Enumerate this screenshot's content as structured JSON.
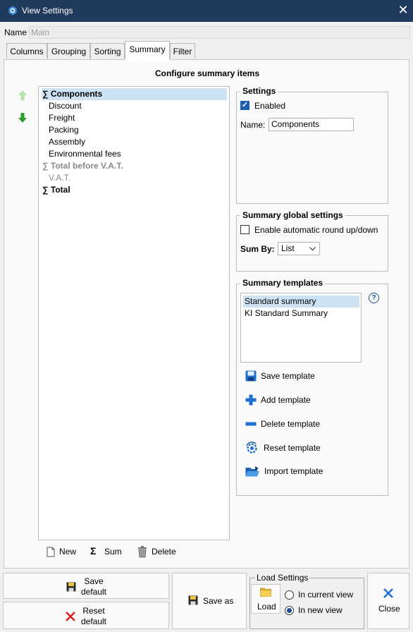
{
  "window": {
    "title": "View Settings",
    "close_glyph": "✕"
  },
  "name_field": {
    "label": "Name",
    "value": "Main"
  },
  "tabs": [
    {
      "label": "Columns"
    },
    {
      "label": "Grouping"
    },
    {
      "label": "Sorting"
    },
    {
      "label": "Summary",
      "active": true
    },
    {
      "label": "Filter"
    }
  ],
  "summary_tab": {
    "heading": "Configure summary items",
    "items": [
      {
        "label": "∑ Components",
        "bold": true,
        "selected": true
      },
      {
        "label": "Discount"
      },
      {
        "label": "Freight"
      },
      {
        "label": "Packing"
      },
      {
        "label": "Assembly"
      },
      {
        "label": "Environmental fees"
      },
      {
        "label": "∑ Total before V.A.T.",
        "bold": true,
        "muted": true
      },
      {
        "label": "V.A.T.",
        "muted": true
      },
      {
        "label": "∑ Total",
        "bold": true
      }
    ],
    "list_actions": {
      "new": "New",
      "sum": "Sum",
      "delete": "Delete"
    },
    "settings": {
      "title": "Settings",
      "enabled_label": "Enabled",
      "enabled": true,
      "name_label": "Name:",
      "name_value": "Components"
    },
    "global_settings": {
      "title": "Summary global settings",
      "round_label": "Enable automatic round up/down",
      "round_enabled": false,
      "sum_by_label": "Sum By:",
      "sum_by_value": "List"
    },
    "templates": {
      "title": "Summary templates",
      "help_glyph": "?",
      "items": [
        {
          "label": "Standard summary",
          "selected": true
        },
        {
          "label": "KI Standard Summary"
        }
      ],
      "actions": {
        "save": "Save template",
        "add": "Add template",
        "delete": "Delete template",
        "reset": "Reset template",
        "import": "Import template"
      }
    }
  },
  "footer": {
    "save_default_line1": "Save",
    "save_default_line2": "default",
    "reset_default_line1": "Reset",
    "reset_default_line2": "default",
    "save_as": "Save as",
    "load_settings_title": "Load Settings",
    "load": "Load",
    "in_current_view": "In current view",
    "in_new_view": "In new view",
    "load_target": "in_new_view",
    "close": "Close"
  },
  "colors": {
    "titlebar": "#1f3a5c",
    "selection": "#cde2f3",
    "accent": "#1a5fb4",
    "arrow_up_disabled": "#b6e3a8",
    "arrow_down": "#2e9b2e",
    "delete_red": "#e02020"
  },
  "icons": {
    "app": "gear-hex-icon",
    "move_up": "arrow-up-icon",
    "move_down": "arrow-down-icon",
    "new": "new-document-icon",
    "sum": "sigma-icon",
    "delete": "trash-icon",
    "save": "floppy-disk-icon",
    "add": "plus-icon",
    "remove": "minus-icon",
    "reset": "reset-gear-icon",
    "import": "folder-open-icon",
    "reset_default": "red-x-icon",
    "load": "folder-icon",
    "close": "blue-x-icon"
  }
}
